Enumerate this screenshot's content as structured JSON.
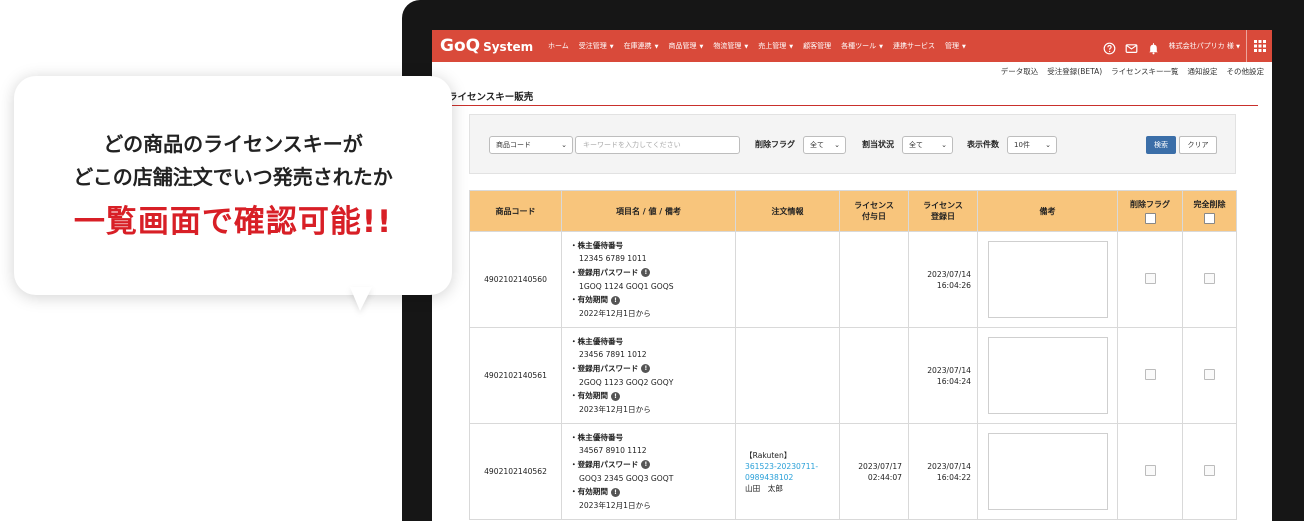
{
  "bubble": {
    "line1": "どの商品のライセンスキーが",
    "line2": "どこの店舗注文でいつ発売されたか",
    "line3": "一覧画面で確認可能!!"
  },
  "nav": {
    "logo": "GoQ",
    "logo_sub": "System",
    "items": [
      {
        "label": "ホーム",
        "dropdown": false
      },
      {
        "label": "受注管理",
        "dropdown": true
      },
      {
        "label": "在庫連携",
        "dropdown": true
      },
      {
        "label": "商品管理",
        "dropdown": true
      },
      {
        "label": "物流管理",
        "dropdown": true
      },
      {
        "label": "売上管理",
        "dropdown": true
      },
      {
        "label": "顧客管理",
        "dropdown": false
      },
      {
        "label": "各種ツール",
        "dropdown": true
      },
      {
        "label": "連携サービス",
        "dropdown": false
      },
      {
        "label": "管理",
        "dropdown": true
      }
    ],
    "caret": "▼",
    "company": "株式会社パプリカ 様",
    "company_caret": "▼"
  },
  "subnav": [
    "データ取込",
    "受注登録(BETA)",
    "ライセンスキー一覧",
    "通知設定",
    "その他設定"
  ],
  "page_title": "ライセンスキー販売",
  "filter": {
    "field_select": "商品コード",
    "keyword_placeholder": "キーワードを入力してください",
    "delete_flag_label": "削除フラグ",
    "delete_flag_value": "全て",
    "assign_label": "割当状況",
    "assign_value": "全て",
    "count_label": "表示件数",
    "count_value": "10件",
    "search_button": "検索",
    "clear_button": "クリア"
  },
  "table": {
    "headers": {
      "code": "商品コード",
      "item": "項目名 / 値 / 備考",
      "order": "注文情報",
      "assigned_line1": "ライセンス",
      "assigned_line2": "付与日",
      "registered_line1": "ライセンス",
      "registered_line2": "登録日",
      "memo": "備考",
      "delete_flag": "削除フラグ",
      "full_delete": "完全削除"
    },
    "rows": [
      {
        "code": "4902102140560",
        "k1": "・株主優待番号",
        "v1": "12345 6789 1011",
        "k2": "・登録用パスワード",
        "v2": "1GOQ 1124 GOQ1 GOQS",
        "k3": "・有効期間",
        "v3": "2022年12月1日から",
        "order_shop": "",
        "order_no_1": "",
        "order_no_2": "",
        "order_name": "",
        "assigned_date": "",
        "assigned_time": "",
        "registered_date": "2023/07/14",
        "registered_time": "16:04:26"
      },
      {
        "code": "4902102140561",
        "k1": "・株主優待番号",
        "v1": "23456 7891 1012",
        "k2": "・登録用パスワード",
        "v2": "2GOQ 1123 GOQ2 GOQY",
        "k3": "・有効期間",
        "v3": "2023年12月1日から",
        "order_shop": "",
        "order_no_1": "",
        "order_no_2": "",
        "order_name": "",
        "assigned_date": "",
        "assigned_time": "",
        "registered_date": "2023/07/14",
        "registered_time": "16:04:24"
      },
      {
        "code": "4902102140562",
        "k1": "・株主優待番号",
        "v1": "34567 8910 1112",
        "k2": "・登録用パスワード",
        "v2": "GOQ3 2345 GOQ3 GOQT",
        "k3": "・有効期間",
        "v3": "2023年12月1日から",
        "order_shop": "【Rakuten】",
        "order_no_1": "361523-20230711-",
        "order_no_2": "0989438102",
        "order_name": "山田　太郎",
        "assigned_date": "2023/07/17",
        "assigned_time": "02:44:07",
        "registered_date": "2023/07/14",
        "registered_time": "16:04:22"
      }
    ],
    "info_glyph": "!"
  },
  "colors": {
    "navbar": "#d94a3a",
    "header_cell": "#f8c57c",
    "accent_red": "#d81f26",
    "link": "#2aa0d8",
    "search_button": "#3b6ea8"
  }
}
